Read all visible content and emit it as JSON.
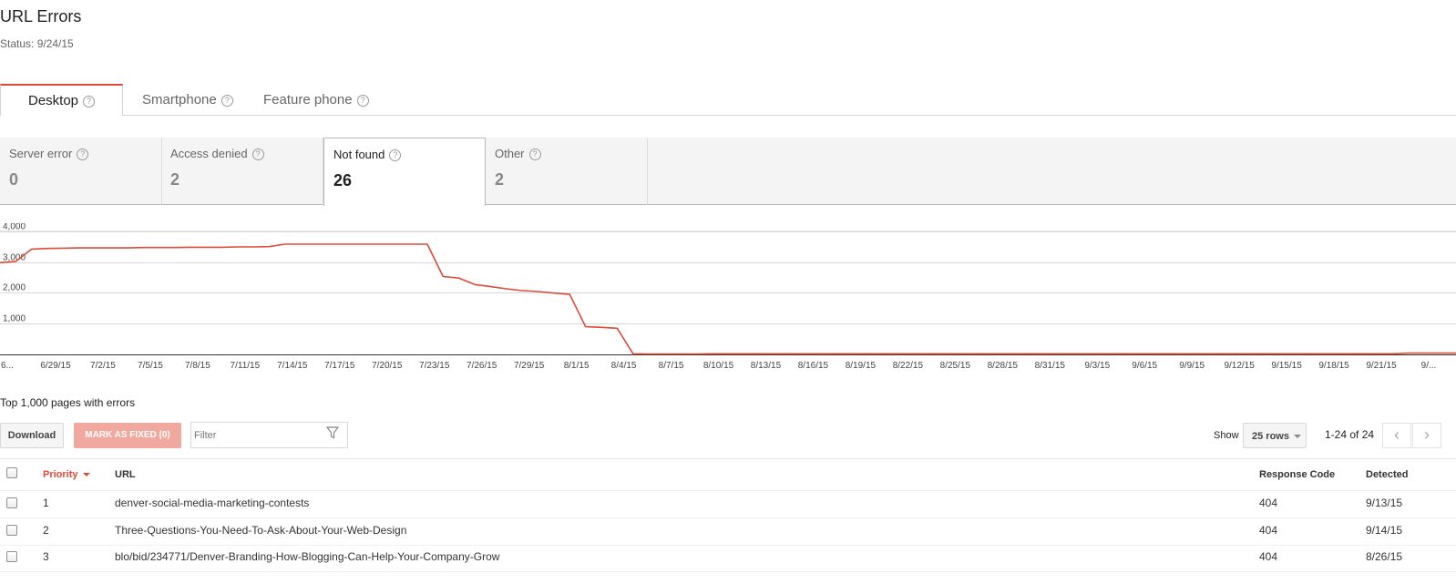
{
  "page": {
    "title": "URL Errors",
    "status": "Status: 9/24/15"
  },
  "tabs": [
    {
      "label": "Desktop",
      "active": true
    },
    {
      "label": "Smartphone",
      "active": false
    },
    {
      "label": "Feature phone",
      "active": false
    }
  ],
  "help_glyph": "?",
  "categories": [
    {
      "label": "Server error",
      "value": "0"
    },
    {
      "label": "Access denied",
      "value": "2"
    },
    {
      "label": "Not found",
      "value": "26",
      "selected": true
    },
    {
      "label": "Other",
      "value": "2"
    }
  ],
  "chart_data": {
    "type": "line",
    "series_color": "#dd4b39",
    "y_ticks": [
      "1,000",
      "2,000",
      "3,000",
      "4,000"
    ],
    "ylim": [
      0,
      4000
    ],
    "x_tick_labels": [
      "6...",
      "6/29/15",
      "7/2/15",
      "7/5/15",
      "7/8/15",
      "7/11/15",
      "7/14/15",
      "7/17/15",
      "7/20/15",
      "7/23/15",
      "7/26/15",
      "7/29/15",
      "8/1/15",
      "8/4/15",
      "8/7/15",
      "8/10/15",
      "8/13/15",
      "8/16/15",
      "8/19/15",
      "8/22/15",
      "8/25/15",
      "8/28/15",
      "8/31/15",
      "9/3/15",
      "9/6/15",
      "9/9/15",
      "9/12/15",
      "9/15/15",
      "9/18/15",
      "9/21/15",
      "9/..."
    ],
    "series": [
      {
        "values": [
          2980,
          3020,
          3420,
          3440,
          3450,
          3460,
          3460,
          3460,
          3460,
          3470,
          3470,
          3470,
          3480,
          3480,
          3480,
          3490,
          3490,
          3500,
          3580,
          3580,
          3580,
          3580,
          3580,
          3580,
          3580,
          3580,
          3580,
          3580,
          2530,
          2480,
          2270,
          2200,
          2130,
          2070,
          2040,
          1990,
          1950,
          900,
          880,
          850,
          20,
          15,
          15,
          15,
          15,
          20,
          20,
          20,
          20,
          20,
          20,
          20,
          20,
          20,
          20,
          20,
          20,
          20,
          20,
          20,
          20,
          20,
          20,
          20,
          20,
          20,
          20,
          20,
          20,
          20,
          20,
          20,
          20,
          20,
          20,
          20,
          20,
          20,
          20,
          20,
          20,
          20,
          20,
          20,
          20,
          20,
          20,
          20,
          20,
          40,
          40,
          40,
          40
        ]
      }
    ]
  },
  "table_section": {
    "heading": "Top 1,000 pages with errors",
    "download_label": "Download",
    "mark_fixed_label": "MARK AS FIXED (0)",
    "filter_placeholder": "Filter",
    "show_label": "Show",
    "rows_value": "25 rows",
    "pager_text": "1-24 of 24",
    "prev_glyph": "‹",
    "next_glyph": "›"
  },
  "table": {
    "columns": {
      "priority": "Priority",
      "url": "URL",
      "response_code": "Response Code",
      "detected": "Detected"
    },
    "rows": [
      {
        "priority": "1",
        "url": "denver-social-media-marketing-contests",
        "response_code": "404",
        "detected": "9/13/15"
      },
      {
        "priority": "2",
        "url": "Three-Questions-You-Need-To-Ask-About-Your-Web-Design",
        "response_code": "404",
        "detected": "9/14/15"
      },
      {
        "priority": "3",
        "url": "blo/bid/234771/Denver-Branding-How-Blogging-Can-Help-Your-Company-Grow",
        "response_code": "404",
        "detected": "8/26/15"
      }
    ]
  }
}
